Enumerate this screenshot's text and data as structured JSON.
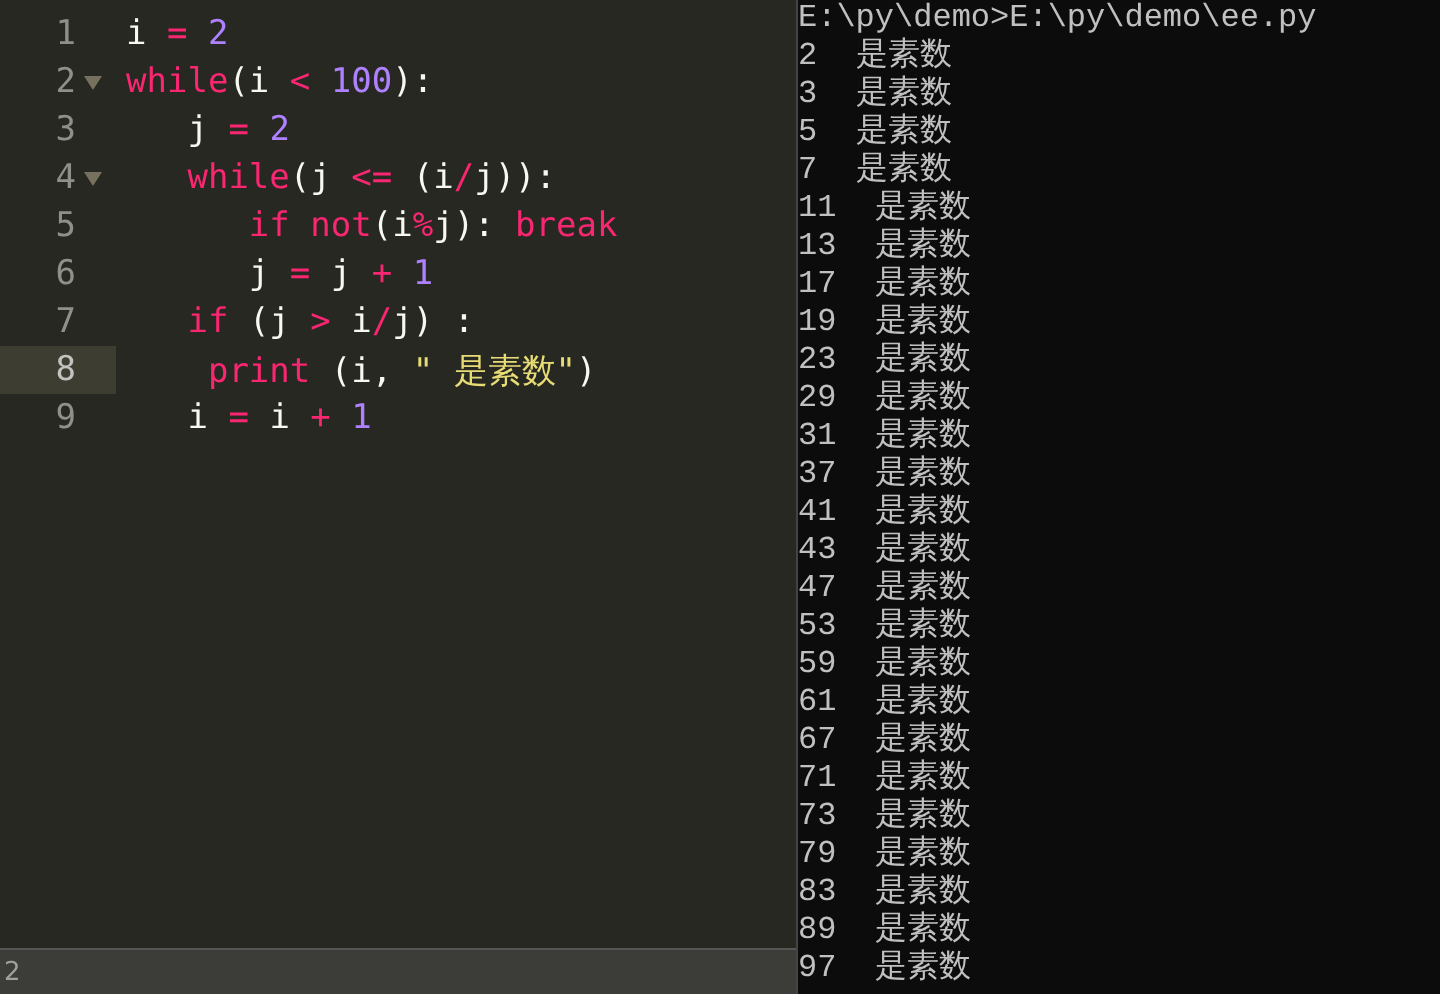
{
  "editor": {
    "lines": [
      {
        "number": "1",
        "current": false,
        "tokens": [
          {
            "kind": "var",
            "text": "i "
          },
          {
            "kind": "op",
            "text": "="
          },
          {
            "kind": "num",
            "text": " 2"
          }
        ]
      },
      {
        "number": "2",
        "current": false,
        "fold_open": true,
        "tokens": [
          {
            "kind": "kw",
            "text": "while"
          },
          {
            "kind": "var",
            "text": "(i "
          },
          {
            "kind": "op",
            "text": "<"
          },
          {
            "kind": "num",
            "text": " 100"
          },
          {
            "kind": "var",
            "text": "):"
          }
        ]
      },
      {
        "number": "3",
        "current": false,
        "tokens": [
          {
            "kind": "var",
            "text": "\tj "
          },
          {
            "kind": "op",
            "text": "="
          },
          {
            "kind": "num",
            "text": " 2"
          }
        ]
      },
      {
        "number": "4",
        "current": false,
        "fold_open": true,
        "tokens": [
          {
            "kind": "kw",
            "text": "\twhile"
          },
          {
            "kind": "var",
            "text": "(j "
          },
          {
            "kind": "op",
            "text": "<="
          },
          {
            "kind": "var",
            "text": " (i"
          },
          {
            "kind": "op",
            "text": "/"
          },
          {
            "kind": "var",
            "text": "j)):"
          }
        ]
      },
      {
        "number": "5",
        "current": false,
        "tokens": [
          {
            "kind": "kw",
            "text": "\t\tif not"
          },
          {
            "kind": "var",
            "text": "(i"
          },
          {
            "kind": "op",
            "text": "%"
          },
          {
            "kind": "var",
            "text": "j): "
          },
          {
            "kind": "kw",
            "text": "break"
          }
        ]
      },
      {
        "number": "6",
        "current": false,
        "tokens": [
          {
            "kind": "var",
            "text": "\t\tj "
          },
          {
            "kind": "op",
            "text": "="
          },
          {
            "kind": "var",
            "text": " j "
          },
          {
            "kind": "op",
            "text": "+"
          },
          {
            "kind": "num",
            "text": " 1"
          }
        ]
      },
      {
        "number": "7",
        "current": false,
        "tokens": [
          {
            "kind": "kw",
            "text": "\tif"
          },
          {
            "kind": "var",
            "text": " (j "
          },
          {
            "kind": "op",
            "text": ">"
          },
          {
            "kind": "var",
            "text": " i"
          },
          {
            "kind": "op",
            "text": "/"
          },
          {
            "kind": "var",
            "text": "j) :"
          }
        ]
      },
      {
        "number": "8",
        "current": true,
        "tokens": [
          {
            "kind": "kw",
            "text": "\t print"
          },
          {
            "kind": "var",
            "text": " (i, "
          },
          {
            "kind": "str",
            "text": "\" 是素数\""
          },
          {
            "kind": "var",
            "text": ")"
          }
        ]
      },
      {
        "number": "9",
        "current": false,
        "tokens": [
          {
            "kind": "var",
            "text": "\ti "
          },
          {
            "kind": "op",
            "text": "="
          },
          {
            "kind": "var",
            "text": " i "
          },
          {
            "kind": "op",
            "text": "+"
          },
          {
            "kind": "num",
            "text": " 1"
          }
        ]
      }
    ]
  },
  "status_bar": {
    "text": "2"
  },
  "console": {
    "lines": [
      "E:\\py\\demo>E:\\py\\demo\\ee.py",
      "2  是素数",
      "3  是素数",
      "5  是素数",
      "7  是素数",
      "11  是素数",
      "13  是素数",
      "17  是素数",
      "19  是素数",
      "23  是素数",
      "29  是素数",
      "31  是素数",
      "37  是素数",
      "41  是素数",
      "43  是素数",
      "47  是素数",
      "53  是素数",
      "59  是素数",
      "61  是素数",
      "67  是素数",
      "71  是素数",
      "73  是素数",
      "79  是素数",
      "83  是素数",
      "89  是素数",
      "97  是素数"
    ]
  }
}
